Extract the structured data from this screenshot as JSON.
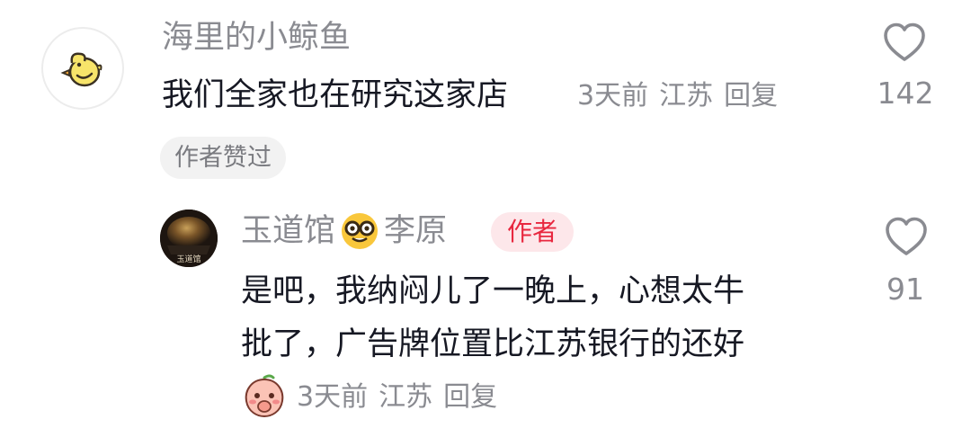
{
  "comment": {
    "username": "海里的小鲸鱼",
    "text": "我们全家也在研究这家店",
    "time": "3天前",
    "location": "江苏",
    "reply_label": "回复",
    "like_count": "142",
    "author_liked_badge": "作者赞过",
    "avatar_icon": "yellow-chick-icon"
  },
  "reply": {
    "username_part1": "玉道馆",
    "username_emoji": "nerd-face-emoji",
    "username_part2": "李原",
    "author_tag": "作者",
    "text_line1": "是吧，我纳闷儿了一晚上，心想太牛",
    "text_line2": "批了，广告牌位置比江苏银行的还好",
    "sticker": "peach-face-sticker",
    "time": "3天前",
    "location": "江苏",
    "reply_label": "回复",
    "like_count": "91",
    "avatar_text": "玉道馆"
  },
  "colors": {
    "primary_text": "#161823",
    "secondary_text": "#8a8b91",
    "author_tag_bg": "#fde7ea",
    "author_tag_text": "#e8273f",
    "badge_bg": "#f2f2f2"
  }
}
